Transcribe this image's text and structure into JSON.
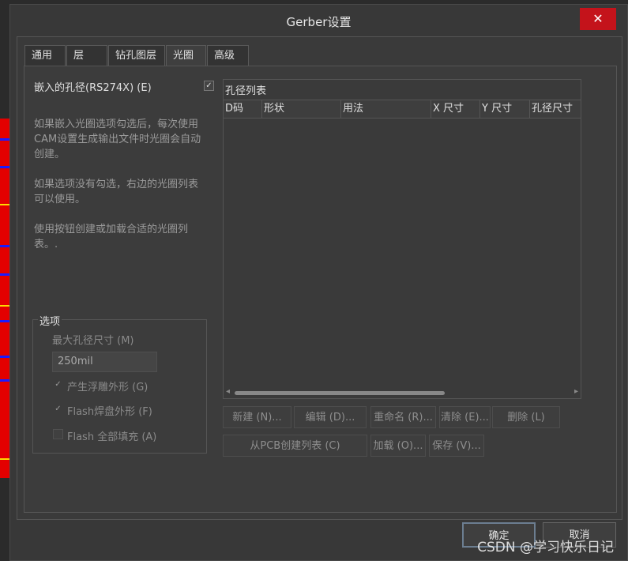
{
  "window": {
    "title": "Gerber设置",
    "close_glyph": "✕"
  },
  "tabs": [
    {
      "label": "通用"
    },
    {
      "label": "层"
    },
    {
      "label": "钻孔图层"
    },
    {
      "label": "光圈"
    },
    {
      "label": "高级"
    }
  ],
  "embedded": {
    "label": "嵌入的孔径(RS274X) (E)",
    "checked": true,
    "check_glyph": "✓"
  },
  "descriptions": {
    "p1": "如果嵌入光圈选项勾选后，每次使用CAM设置生成输出文件时光圈会自动创建。",
    "p2": "如果选项没有勾选，右边的光圈列表可以使用。",
    "p3": "使用按钮创建或加载合适的光圈列表。."
  },
  "options": {
    "title": "选项",
    "max_size_label": "最大孔径尺寸 (M)",
    "max_size_value": "250mil",
    "opt1": {
      "label": "产生浮雕外形 (G)",
      "checked": true
    },
    "opt2": {
      "label": "Flash焊盘外形 (F)",
      "checked": true
    },
    "opt3": {
      "label": "Flash 全部填充 (A)",
      "checked": false
    }
  },
  "aperture_list": {
    "title": "孔径列表",
    "columns": [
      "D码",
      "形状",
      "用法",
      "X 尺寸",
      "Y 尺寸",
      "孔径尺寸"
    ],
    "rows": [],
    "scroll_left": "◂",
    "scroll_right": "▸"
  },
  "buttons": {
    "new": "新建 (N)...",
    "edit": "编辑 (D)...",
    "rename": "重命名 (R)...",
    "clear": "清除 (E)...",
    "delete": "删除 (L)",
    "from_pcb": "从PCB创建列表 (C)",
    "load": "加载 (O)...",
    "save": "保存 (V)..."
  },
  "footer": {
    "ok": "确定",
    "cancel": "取消"
  },
  "watermark": "CSDN @学习快乐日记",
  "colors": {
    "accent_close": "#c4131b",
    "pcb_red": "#e30000",
    "pcb_blue": "#1a1aff",
    "pcb_yellow": "#ffd800"
  }
}
